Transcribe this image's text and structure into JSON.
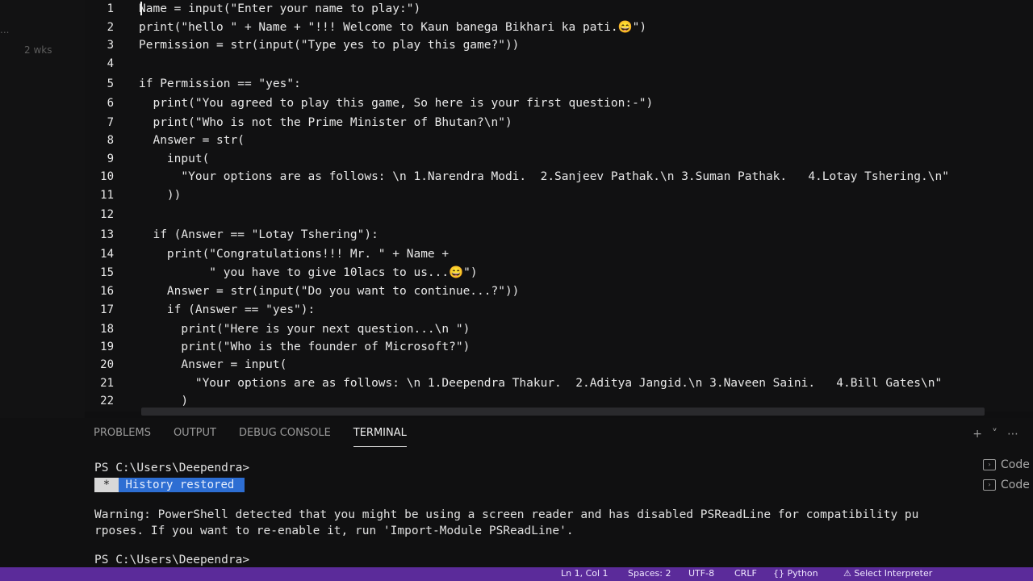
{
  "sidebar": {
    "tokens": [
      "...",
      "2 wks"
    ]
  },
  "editor": {
    "lines": [
      {
        "n": "1",
        "text": "Name = input(\"Enter your name to play:\")"
      },
      {
        "n": "2",
        "text": "print(\"hello \" + Name + \"!!! Welcome to Kaun banega Bikhari ka pati.😄\")"
      },
      {
        "n": "3",
        "text": "Permission = str(input(\"Type yes to play this game?\"))"
      },
      {
        "n": "4",
        "text": ""
      },
      {
        "n": "5",
        "text": "if Permission == \"yes\":"
      },
      {
        "n": "6",
        "text": "  print(\"You agreed to play this game, So here is your first question:-\")"
      },
      {
        "n": "7",
        "text": "  print(\"Who is not the Prime Minister of Bhutan?\\n\")"
      },
      {
        "n": "8",
        "text": "  Answer = str("
      },
      {
        "n": "9",
        "text": "    input("
      },
      {
        "n": "10",
        "text": "      \"Your options are as follows: \\n 1.Narendra Modi.  2.Sanjeev Pathak.\\n 3.Suman Pathak.   4.Lotay Tshering.\\n\""
      },
      {
        "n": "11",
        "text": "    ))"
      },
      {
        "n": "12",
        "text": ""
      },
      {
        "n": "13",
        "text": "  if (Answer == \"Lotay Tshering\"):"
      },
      {
        "n": "14",
        "text": "    print(\"Congratulations!!! Mr. \" + Name +"
      },
      {
        "n": "15",
        "text": "          \" you have to give 10lacs to us...😄\")"
      },
      {
        "n": "16",
        "text": "    Answer = str(input(\"Do you want to continue...?\"))"
      },
      {
        "n": "17",
        "text": "    if (Answer == \"yes\"):"
      },
      {
        "n": "18",
        "text": "      print(\"Here is your next question...\\n \")"
      },
      {
        "n": "19",
        "text": "      print(\"Who is the founder of Microsoft?\")"
      },
      {
        "n": "20",
        "text": "      Answer = input("
      },
      {
        "n": "21",
        "text": "        \"Your options are as follows: \\n 1.Deependra Thakur.  2.Aditya Jangid.\\n 3.Naveen Saini.   4.Bill Gates\\n\""
      },
      {
        "n": "22",
        "text": "      )"
      }
    ]
  },
  "panel": {
    "tabs": [
      "PROBLEMS",
      "OUTPUT",
      "DEBUG CONSOLE",
      "TERMINAL"
    ],
    "active_tab": "TERMINAL",
    "actions": [
      "+",
      "˅",
      "⋯"
    ],
    "terminal_sessions": [
      "Code",
      "Code"
    ],
    "terminal": {
      "prompt1": "PS C:\\Users\\Deependra>",
      "history_star": "*",
      "history_text": "History restored",
      "warning1": "Warning: PowerShell detected that you might be using a screen reader and has disabled PSReadLine for compatibility pu",
      "warning2": "rposes. If you want to re-enable it, run 'Import-Module PSReadLine'.",
      "prompt2": "PS C:\\Users\\Deependra>"
    }
  },
  "status": {
    "items": [
      "Ln 1, Col 1",
      "Spaces: 2",
      "UTF-8",
      "CRLF",
      "{} Python",
      "⚠ Select Interpreter"
    ]
  },
  "colors": {
    "status_bar": "#5b2b9a",
    "history_badge": "#2d6ed3"
  }
}
